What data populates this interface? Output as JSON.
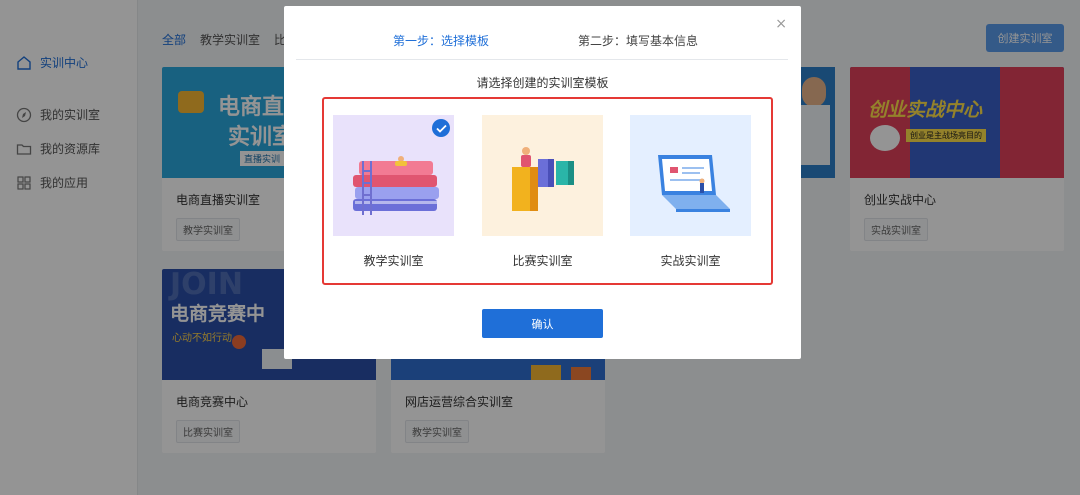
{
  "sidebar": {
    "items": [
      {
        "label": "实训中心",
        "icon": "home-icon"
      },
      {
        "label": "我的实训室",
        "icon": "compass-icon"
      },
      {
        "label": "我的资源库",
        "icon": "folder-icon"
      },
      {
        "label": "我的应用",
        "icon": "grid-icon"
      }
    ]
  },
  "filters": [
    "全部",
    "教学实训室",
    "比赛"
  ],
  "header": {
    "create_button": "创建实训室"
  },
  "cards": [
    {
      "title": "电商直播实训室",
      "tag": "教学实训室",
      "banner_lines": [
        "电商直",
        "实训室",
        "直播实训"
      ]
    },
    {
      "title": "创业实战中心",
      "tag": "实战实训室",
      "banner_lines": [
        "创业实战中心",
        "创业是主战场亮目的"
      ]
    },
    {
      "title": "电商竞赛中心",
      "tag": "比赛实训室",
      "banner_lines": [
        "JOIN",
        "电商竞赛中",
        "心动不如行动"
      ]
    },
    {
      "title": "网店运营综合实训室",
      "tag": "教学实训室"
    }
  ],
  "modal": {
    "steps": [
      "第一步：选择模板",
      "第二步：填写基本信息"
    ],
    "subtitle": "请选择创建的实训室模板",
    "templates": [
      {
        "label": "教学实训室",
        "selected": true
      },
      {
        "label": "比赛实训室",
        "selected": false
      },
      {
        "label": "实战实训室",
        "selected": false
      }
    ],
    "confirm": "确认",
    "close": "×"
  },
  "colors": {
    "primary": "#1f6fd8",
    "highlight_border": "#e53935"
  }
}
